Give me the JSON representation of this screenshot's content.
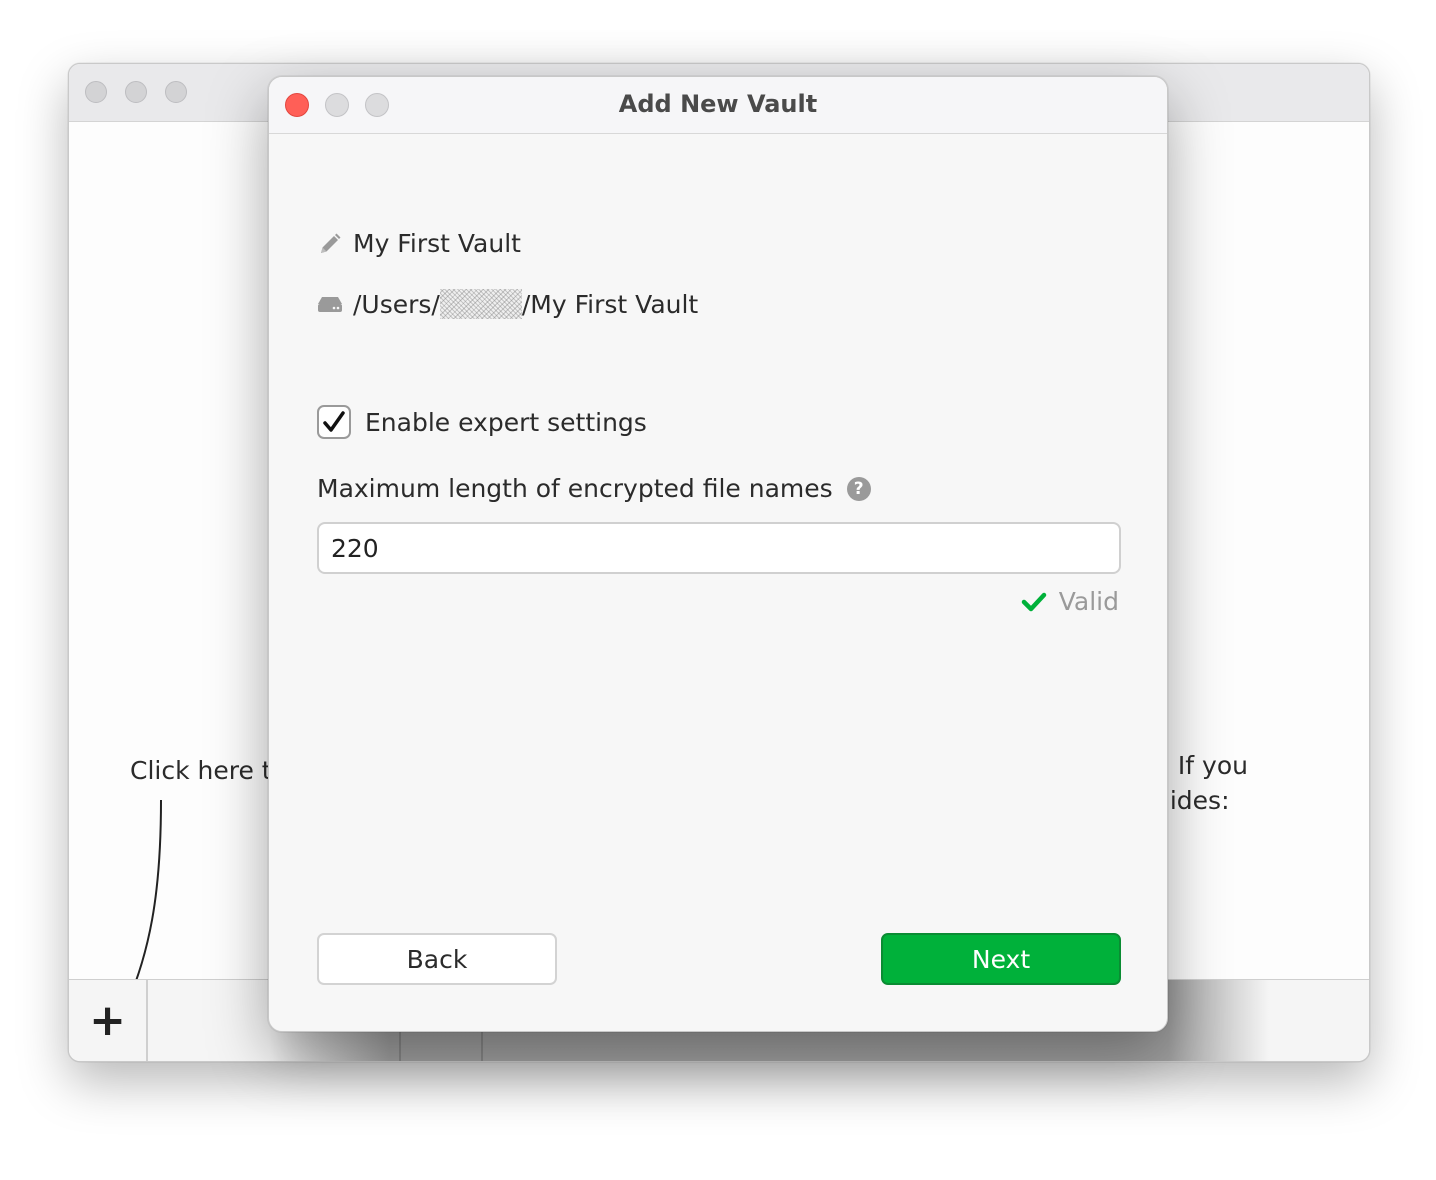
{
  "main_window": {
    "hint_left": "Click here to",
    "hint_right_line1": "s. If you",
    "hint_right_line2": "uides:",
    "add_vault_label": "+",
    "remove_vault_label": "-"
  },
  "dialog": {
    "title": "Add New Vault",
    "vault_name": "My First Vault",
    "vault_path_prefix": "/Users/",
    "vault_path_suffix": "/My First Vault",
    "expert_settings_label": "Enable expert settings",
    "expert_settings_checked": true,
    "max_length_label": "Maximum length of encrypted file names",
    "help_glyph": "?",
    "max_length_value": "220",
    "validation_text": "Valid",
    "back_label": "Back",
    "next_label": "Next"
  },
  "icons": {
    "name": "pencil-icon",
    "path": "drive-icon",
    "help": "question-circle-icon",
    "valid": "check-icon"
  },
  "colors": {
    "accent": "#00b13a",
    "close": "#ff5f57",
    "valid_check": "#00b13a"
  }
}
